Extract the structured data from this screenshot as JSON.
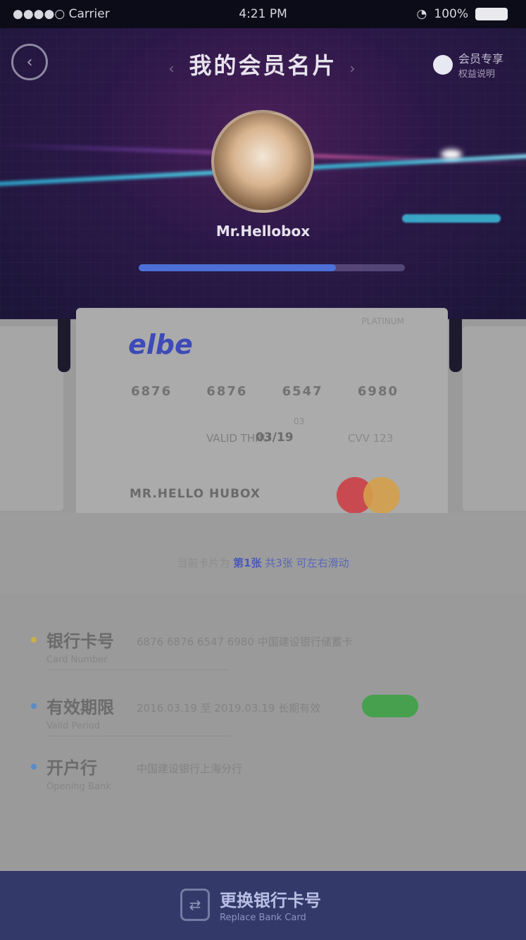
{
  "status_bar": {
    "carrier": "●●●●○ Carrier",
    "wifi": "wifi",
    "time": "4:21 PM",
    "battery_pct": "100%",
    "lock_icon": "lock"
  },
  "header": {
    "title": "我的会员名片",
    "back_icon": "back-circle-icon",
    "right_label": "会员专享",
    "right_sub": "权益说明"
  },
  "profile": {
    "nickname": "Mr.Hellobox",
    "level_progress": 0.74
  },
  "card": {
    "brand": "elbe",
    "brand_tag": "PLATINUM",
    "number_groups": [
      "6876",
      "6876",
      "6547",
      "6980"
    ],
    "exp_tag": "03",
    "exp_label": "VALID THRU",
    "exp_value": "03/19",
    "cvv_label": "CVV 123",
    "holder": "MR.HELLO  HUBOX"
  },
  "info_band": {
    "prefix": "当前卡片为",
    "highlight": "第1张",
    "link": "共3张 可左右滑动"
  },
  "list": {
    "items": [
      {
        "title": "银行卡号",
        "subtitle": "Card Number",
        "desc": "6876 6876 6547 6980 中国建设银行储蓄卡",
        "bullet_color": "#c8b04a"
      },
      {
        "title": "有效期限",
        "subtitle": "Valid Period",
        "desc": "2016.03.19 至 2019.03.19 长期有效",
        "bullet_color": "#5a8ac8"
      },
      {
        "title": "开户行",
        "subtitle": "Opening Bank",
        "desc": "中国建设银行上海分行",
        "bullet_color": "#5a8ac8"
      }
    ]
  },
  "bottom_bar": {
    "title": "更换银行卡号",
    "subtitle": "Replace Bank Card"
  },
  "colors": {
    "brand": "#3d4ab8",
    "accent_green": "#46a04e",
    "bottom_bar": "#333a6a"
  }
}
